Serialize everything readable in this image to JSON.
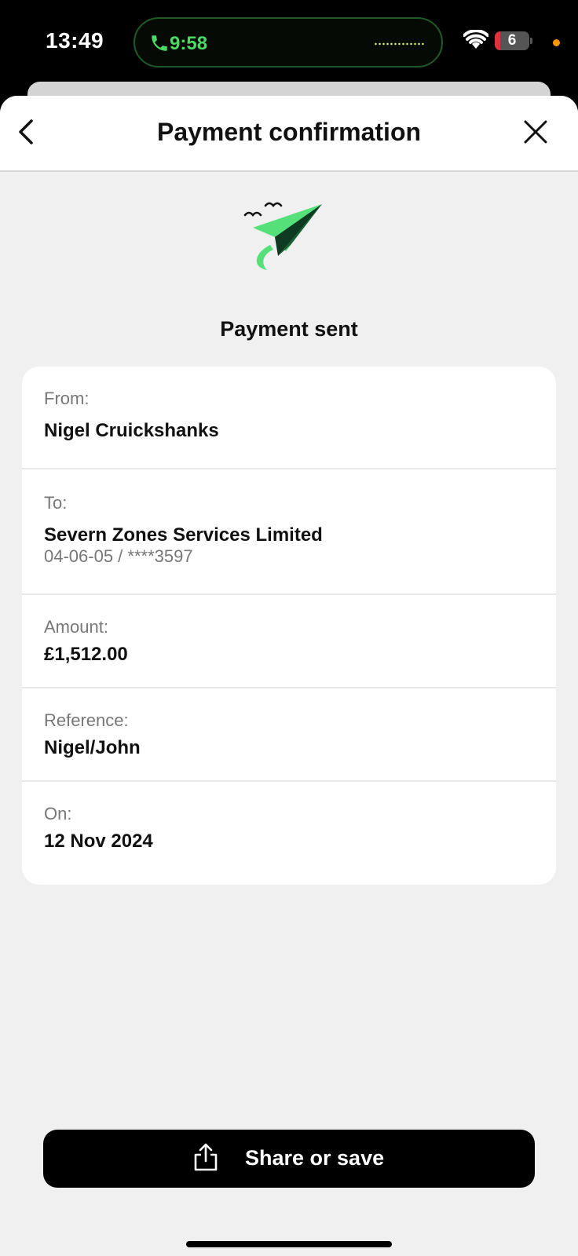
{
  "status_bar": {
    "time": "13:49",
    "call_timer": "9:58",
    "battery_level": "6",
    "battery_fill_fraction": 0.06,
    "recording_dot_color": "#ff9500",
    "call_color": "#4cd964"
  },
  "header": {
    "title": "Payment confirmation",
    "back_icon": "chevron-left-icon",
    "close_icon": "close-icon"
  },
  "hero": {
    "icon": "paper-plane-icon",
    "status_title": "Payment sent",
    "accent_color": "#55e07a"
  },
  "details": {
    "from": {
      "label": "From:",
      "value": "Nigel Cruickshanks"
    },
    "to": {
      "label": "To:",
      "value": "Severn Zones Services Limited",
      "account": "04-06-05 / ****3597"
    },
    "amount": {
      "label": "Amount:",
      "value": "£1,512.00"
    },
    "reference": {
      "label": "Reference:",
      "value": "Nigel/John"
    },
    "on": {
      "label": "On:",
      "value": "12 Nov 2024"
    }
  },
  "actions": {
    "share_label": "Share or save",
    "share_icon": "share-icon"
  }
}
